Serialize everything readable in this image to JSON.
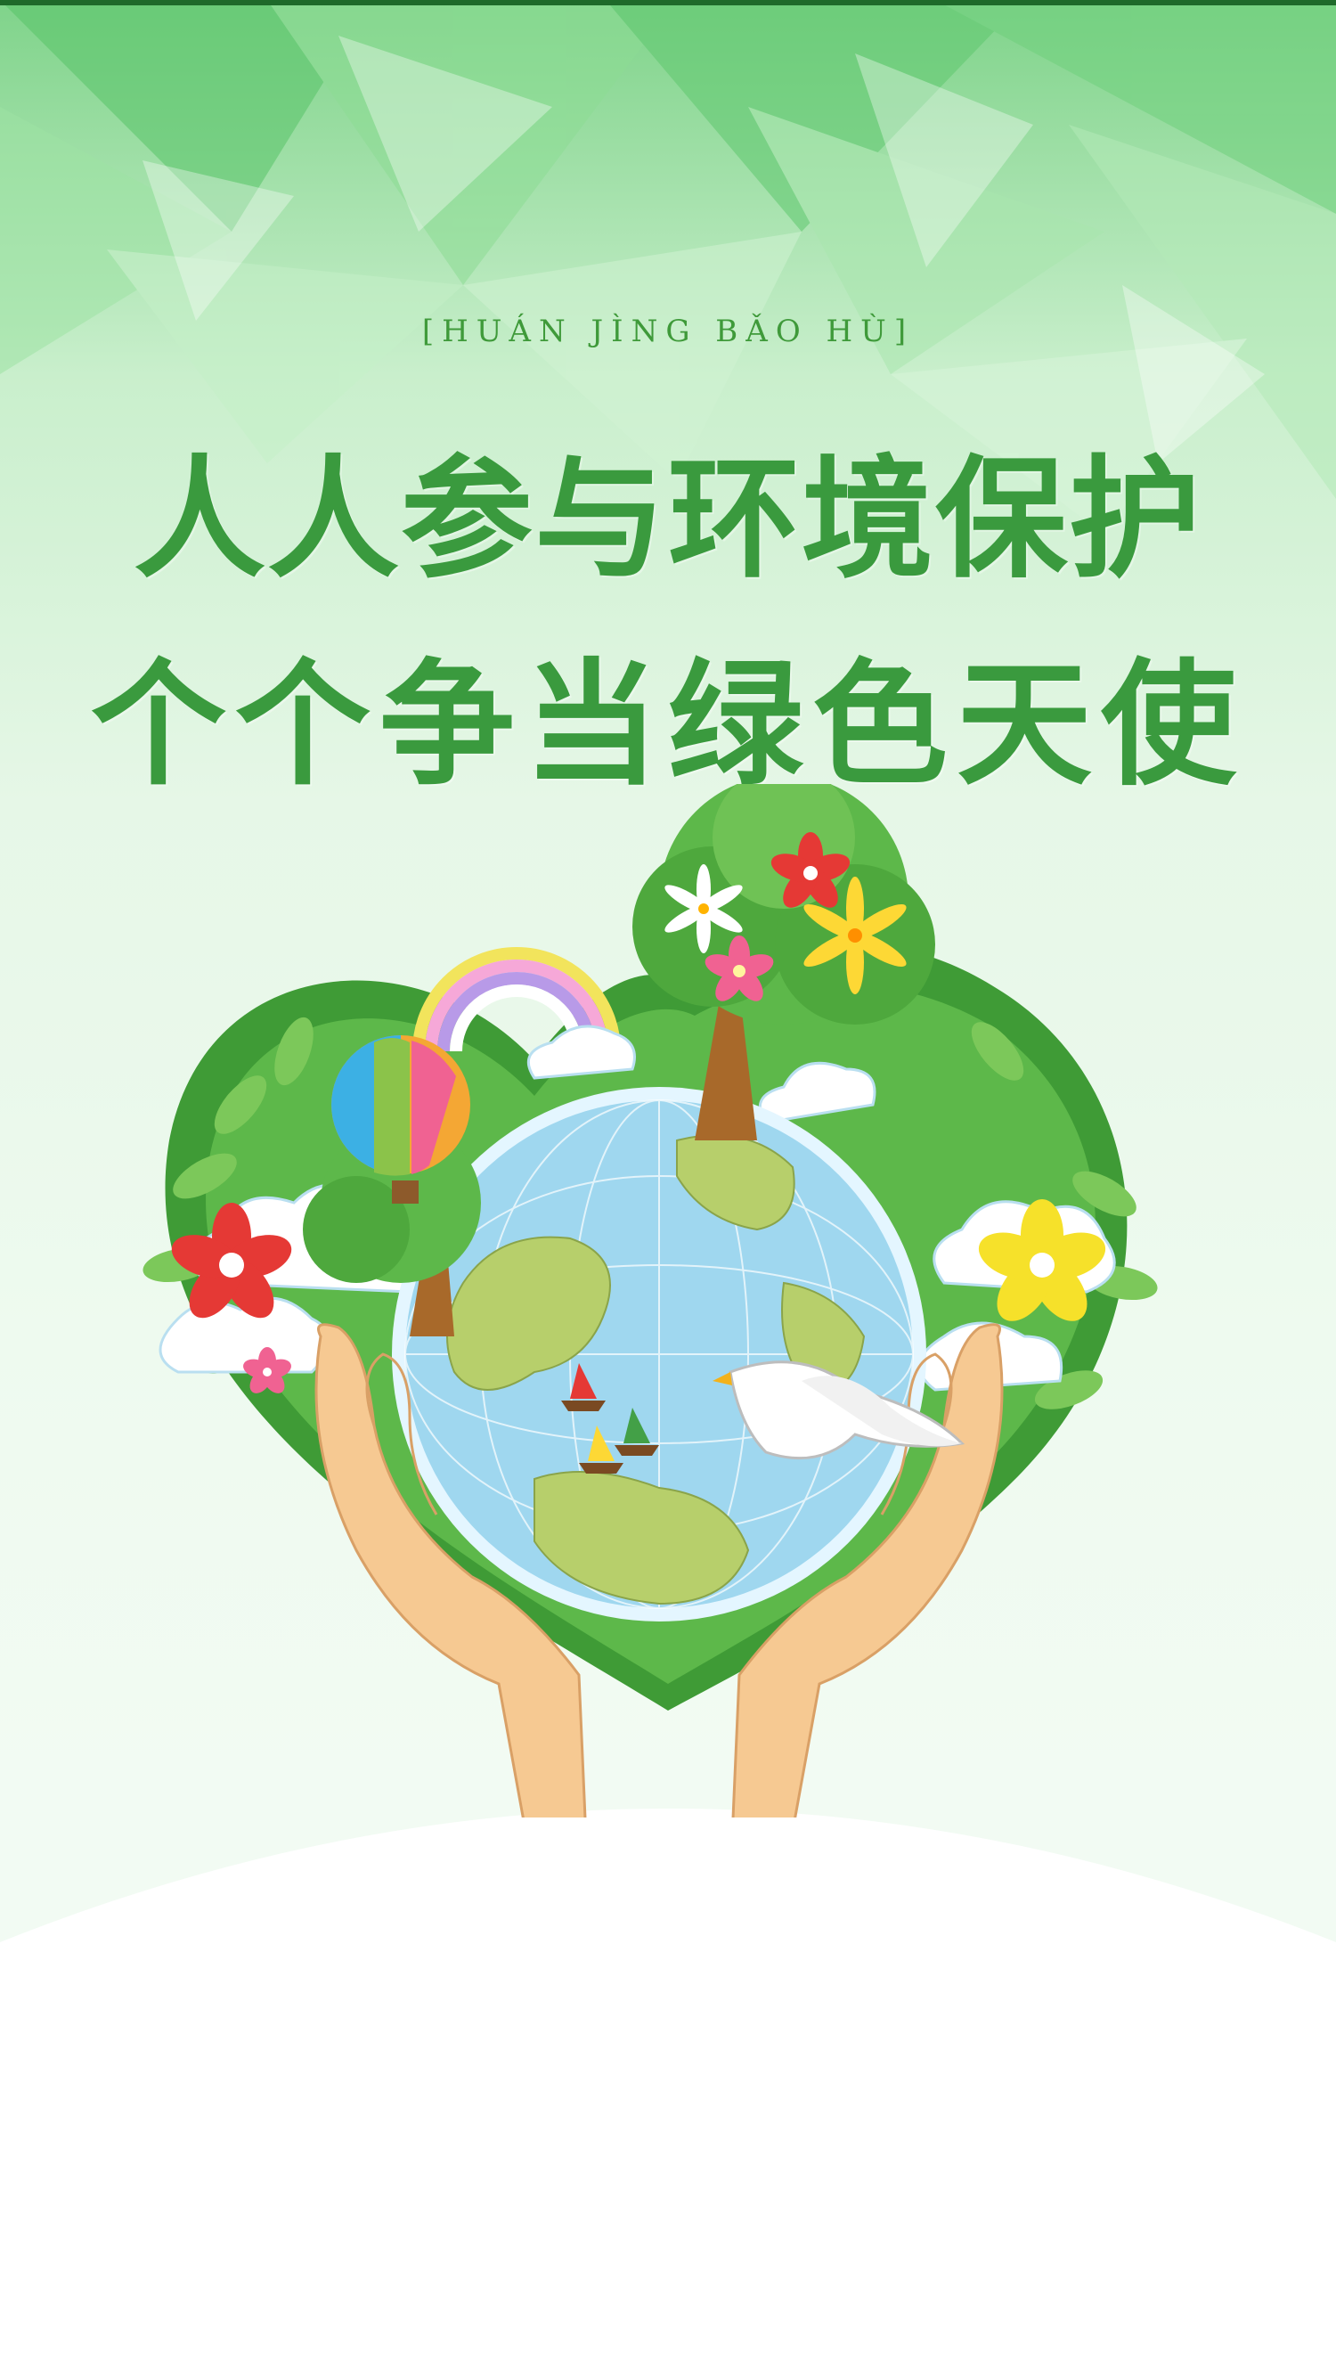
{
  "poster": {
    "subtitle": "[HUÁN JÌNG BǍO HÙ]",
    "title_line_1": "人人参与环境保护",
    "title_line_2": "个个争当绿色天使"
  },
  "colors": {
    "title_green": "#3a9a3e",
    "leaf_green": "#4caf3f",
    "sky_green": "#7fd38a",
    "ocean_blue": "#9fd7ef",
    "land_green": "#b7cf6b",
    "skin": "#f6c992"
  },
  "icons": [
    "globe-icon",
    "hands-icon",
    "rainbow-icon",
    "hot-air-balloon-icon",
    "dove-icon",
    "tree-icon",
    "flower-icon",
    "cloud-icon",
    "sailboat-icon"
  ]
}
